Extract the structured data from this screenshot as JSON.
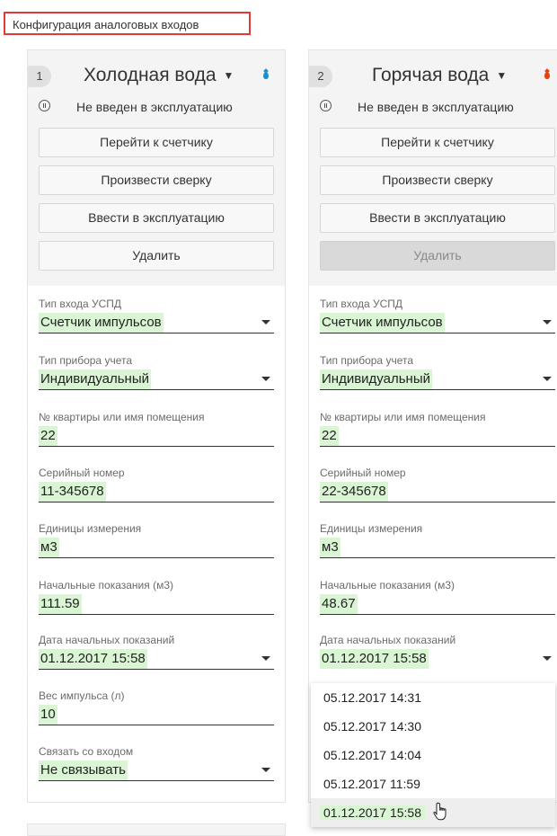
{
  "page": {
    "title": "Конфигурация аналоговых входов"
  },
  "cards": [
    {
      "number": "1",
      "title": "Холодная вода",
      "status": "Не введен в эксплуатацию",
      "drop_color": "#1a8fd8",
      "buttons": {
        "go_meter": "Перейти к счетчику",
        "reconcile": "Произвести сверку",
        "commission": "Ввести в эксплуатацию",
        "delete": "Удалить"
      },
      "fields": {
        "input_type": {
          "label": "Тип входа УСПД",
          "value": "Счетчик импульсов"
        },
        "meter_type": {
          "label": "Тип прибора учета",
          "value": "Индивидуальный"
        },
        "apartment": {
          "label": "№ квартиры или имя помещения",
          "value": "22"
        },
        "serial": {
          "label": "Серийный номер",
          "value": "11-345678"
        },
        "units": {
          "label": "Единицы измерения",
          "value": "м3"
        },
        "initial": {
          "label": "Начальные показания (м3)",
          "value": "111.59"
        },
        "initial_date": {
          "label": "Дата начальных показаний",
          "value": "01.12.2017 15:58"
        },
        "pulse_weight": {
          "label": "Вес импульса (л)",
          "value": "10"
        },
        "link_input": {
          "label": "Связать со входом",
          "value": "Не связывать"
        }
      }
    },
    {
      "number": "2",
      "title": "Горячая вода",
      "status": "Не введен в эксплуатацию",
      "drop_color": "#e8410a",
      "buttons": {
        "go_meter": "Перейти к счетчику",
        "reconcile": "Произвести сверку",
        "commission": "Ввести в эксплуатацию",
        "delete": "Удалить"
      },
      "fields": {
        "input_type": {
          "label": "Тип входа УСПД",
          "value": "Счетчик импульсов"
        },
        "meter_type": {
          "label": "Тип прибора учета",
          "value": "Индивидуальный"
        },
        "apartment": {
          "label": "№ квартиры или имя помещения",
          "value": "22"
        },
        "serial": {
          "label": "Серийный номер",
          "value": "22-345678"
        },
        "units": {
          "label": "Единицы измерения",
          "value": "м3"
        },
        "initial": {
          "label": "Начальные показания (м3)",
          "value": "48.67"
        },
        "initial_date": {
          "label": "Дата начальных показаний",
          "value": "01.12.2017 15:58"
        }
      }
    }
  ],
  "date_menu": {
    "options": [
      "05.12.2017 14:31",
      "05.12.2017 14:30",
      "05.12.2017 14:04",
      "05.12.2017 11:59",
      "01.12.2017 15:58"
    ],
    "hovered": "01.12.2017 15:58"
  },
  "icons": {
    "mode": "pause-circle-icon",
    "cold_water": "water-drop-icon",
    "hot_water": "water-drop-icon",
    "cursor": "hand-pointer-icon"
  }
}
